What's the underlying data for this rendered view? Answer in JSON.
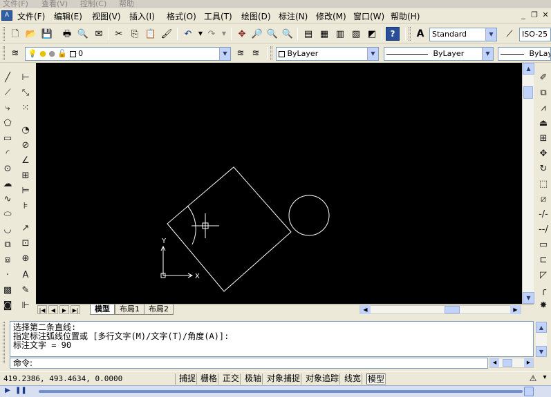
{
  "ghost_menu": [
    "文件(F)",
    "查看(V)",
    "控制(C)",
    "帮助"
  ],
  "menubar": {
    "items": [
      "文件(F)",
      "编辑(E)",
      "视图(V)",
      "插入(I)",
      "格式(O)",
      "工具(T)",
      "绘图(D)",
      "标注(N)",
      "修改(M)",
      "窗口(W)",
      "帮助(H)"
    ]
  },
  "toolbar_standard": {
    "text_style": "Standard",
    "dim_style": "ISO-25"
  },
  "toolbar_layers": {
    "layer_name": "0",
    "color": "ByLayer",
    "linetype": "ByLayer",
    "lineweight": "ByLayer"
  },
  "canvas": {
    "ucs_x": "X",
    "ucs_y": "Y"
  },
  "layout_tabs": [
    "模型",
    "布局1",
    "布局2"
  ],
  "command_history": [
    "选择第二条直线:",
    "指定标注弧线位置或 [多行文字(M)/文字(T)/角度(A)]:",
    "标注文字 = 90"
  ],
  "command_prompt": "命令:",
  "status": {
    "coordinates": "419.2386, 493.4634, 0.0000",
    "toggles": [
      "捕捉",
      "栅格",
      "正交",
      "极轴",
      "对象捕捉",
      "对象追踪",
      "线宽",
      "模型"
    ]
  },
  "colors": {
    "canvas_bg": "#000000",
    "geometry": "#ffffff"
  }
}
